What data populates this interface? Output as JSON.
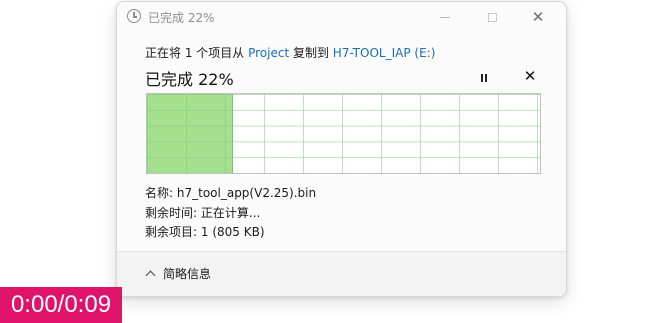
{
  "window": {
    "title": "已完成 22%",
    "icon": "clock-icon"
  },
  "copy": {
    "prefix": "正在将 1 个项目从 ",
    "source": "Project",
    "middle": " 复制到 ",
    "destination": "H7-TOOL_IAP (E:)"
  },
  "status": {
    "text": "已完成 22%",
    "percent": 22,
    "pause_icon": "pause-icon",
    "cancel_icon": "close-icon"
  },
  "info": {
    "name_label": "名称:",
    "name_value": "h7_tool_app(V2.25).bin",
    "time_label": "剩余时间:",
    "time_value": "正在计算...",
    "items_label": "剩余项目:",
    "items_value": "1 (805 KB)"
  },
  "footer": {
    "details_label": "简略信息",
    "chevron_icon": "chevron-up-icon"
  },
  "overlay": {
    "timer": "0:00/0:09",
    "color": "#e0136b"
  },
  "colors": {
    "progress_fill": "#a5e08f",
    "link": "#1a6fb5"
  }
}
